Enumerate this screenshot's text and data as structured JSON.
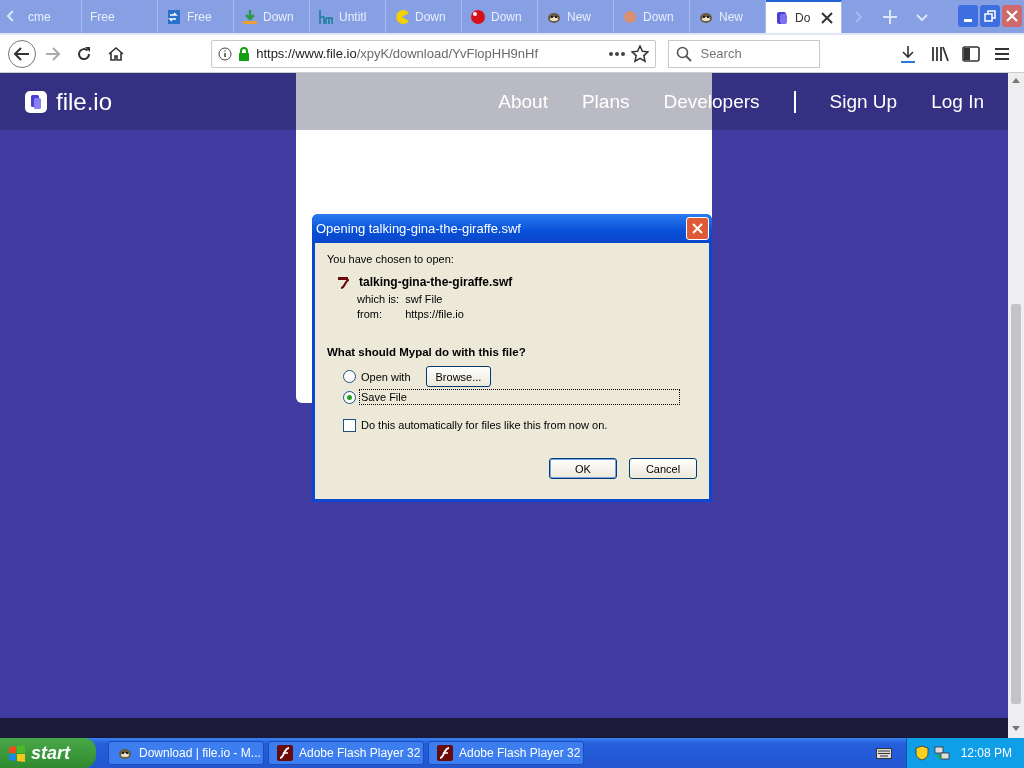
{
  "tabs": [
    {
      "label": "cme",
      "kind": "none",
      "selected": false
    },
    {
      "label": "Free",
      "kind": "none",
      "selected": false
    },
    {
      "label": "Free",
      "kind": "doc",
      "selected": false
    },
    {
      "label": "Down",
      "kind": "download",
      "selected": false
    },
    {
      "label": "Untitl",
      "kind": "hm",
      "selected": false
    },
    {
      "label": "Down",
      "kind": "pac",
      "selected": false
    },
    {
      "label": "Down",
      "kind": "ball",
      "selected": false
    },
    {
      "label": "New",
      "kind": "critter",
      "selected": false
    },
    {
      "label": "Down",
      "kind": "blob",
      "selected": false
    },
    {
      "label": "New",
      "kind": "critter",
      "selected": false
    },
    {
      "label": "Do",
      "kind": "fileio",
      "selected": true
    }
  ],
  "toolbar": {
    "url_host": "https://www.file.io",
    "url_path": "/xpyK/download/YvFlopHH9nHf",
    "search": {
      "placeholder": "Search"
    }
  },
  "site": {
    "logo": "file.io",
    "nav": [
      "About",
      "Plans",
      "Developers"
    ],
    "auth": [
      "Sign Up",
      "Log In"
    ]
  },
  "dialog": {
    "title": "Opening talking-gina-the-giraffe.swf",
    "intro": "You have chosen to open:",
    "file_name": "talking-gina-the-giraffe.swf",
    "details": [
      {
        "label": "which is:",
        "value": "swf File"
      },
      {
        "label": "from:",
        "value": "https://file.io"
      }
    ],
    "question": "What should Mypal do with this file?",
    "options": [
      {
        "label": "Open with",
        "selected": false,
        "button": "Browse..."
      },
      {
        "label": "Save File",
        "selected": true
      }
    ],
    "auto": {
      "label": "Do this automatically for files like this from now on.",
      "checked": false
    },
    "buttons": [
      "OK",
      "Cancel"
    ]
  },
  "taskbar": {
    "start": "start",
    "tasks": [
      {
        "label": "Download | file.io - M...",
        "kind": "critter"
      },
      {
        "label": "Adobe Flash Player 32",
        "kind": "flash"
      },
      {
        "label": "Adobe Flash Player 32",
        "kind": "flash"
      }
    ],
    "clock": "12:08 PM"
  }
}
